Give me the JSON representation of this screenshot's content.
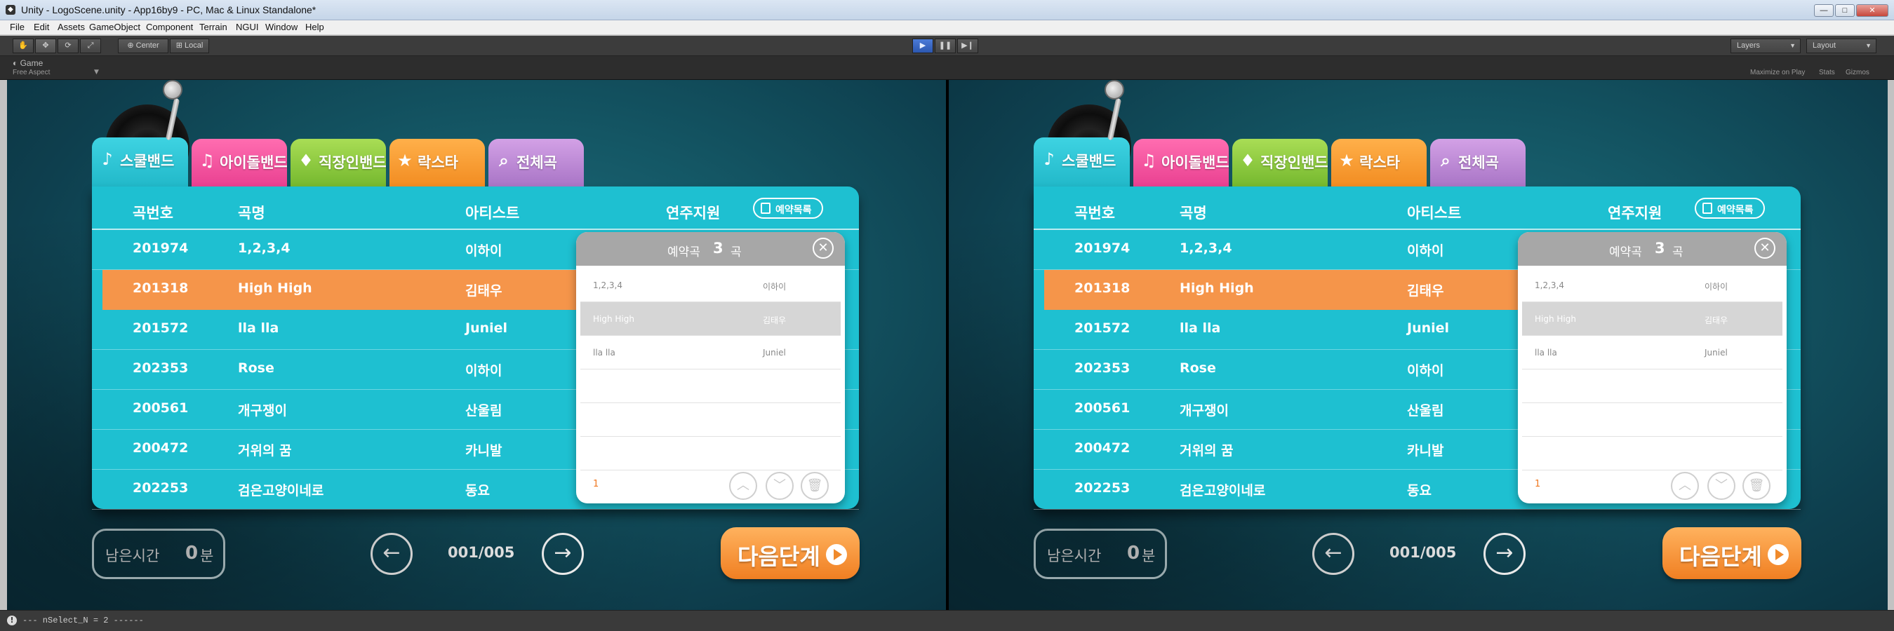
{
  "window": {
    "title": "Unity - LogoScene.unity - App16by9 - PC, Mac & Linux Standalone*",
    "min": "—",
    "max": "□",
    "close": "✕"
  },
  "menu": [
    "File",
    "Edit",
    "Assets",
    "GameObject",
    "Component",
    "Terrain",
    "NGUI",
    "Window",
    "Help"
  ],
  "toolbar": {
    "center": "Center",
    "local": "Local",
    "layers": "Layers",
    "layout": "Layout"
  },
  "game_view": {
    "tab": "Game",
    "aspect": "Free Aspect",
    "maximize": "Maximize on Play",
    "stats": "Stats",
    "gizmos": "Gizmos"
  },
  "tabs": [
    {
      "label": "스쿨밴드",
      "icon": "♪"
    },
    {
      "label": "아이돌밴드",
      "icon": "♫"
    },
    {
      "label": "직장인밴드",
      "icon": "♦"
    },
    {
      "label": "락스타",
      "icon": "★"
    },
    {
      "label": "전체곡",
      "icon": "⌕"
    }
  ],
  "table": {
    "headers": {
      "num": "곡번호",
      "title": "곡명",
      "artist": "아티스트",
      "support": "연주지원"
    },
    "rows": [
      {
        "num": "201974",
        "title": "1,2,3,4",
        "artist": "이하이"
      },
      {
        "num": "201318",
        "title": "High High",
        "artist": "김태우"
      },
      {
        "num": "201572",
        "title": "lla lla",
        "artist": "Juniel"
      },
      {
        "num": "202353",
        "title": "Rose",
        "artist": "이하이"
      },
      {
        "num": "200561",
        "title": "개구쟁이",
        "artist": "산울림"
      },
      {
        "num": "200472",
        "title": "거위의 꿈",
        "artist": "카니발"
      },
      {
        "num": "202253",
        "title": "검은고양이네로",
        "artist": "동요"
      }
    ]
  },
  "reserve_button": "예약목록",
  "popup": {
    "title": "예약곡",
    "count": "3",
    "unit": "곡",
    "close": "✕",
    "items": [
      {
        "title": "1,2,3,4",
        "artist": "이하이"
      },
      {
        "title": "High High",
        "artist": "김태우"
      },
      {
        "title": "lla lla",
        "artist": "Juniel"
      },
      {
        "title": "",
        "artist": ""
      },
      {
        "title": "",
        "artist": ""
      },
      {
        "title": "",
        "artist": ""
      }
    ],
    "page": "1",
    "up": "︿",
    "down": "﹀",
    "trash": "🗑"
  },
  "bottom": {
    "time_label": "남은시간",
    "time_value": "0",
    "time_unit": "분",
    "prev": "←",
    "next": "→",
    "page": "001/005",
    "next_step": "다음단계"
  },
  "status": {
    "icon": "!",
    "text": "--- nSelect_N = 2 ------"
  }
}
